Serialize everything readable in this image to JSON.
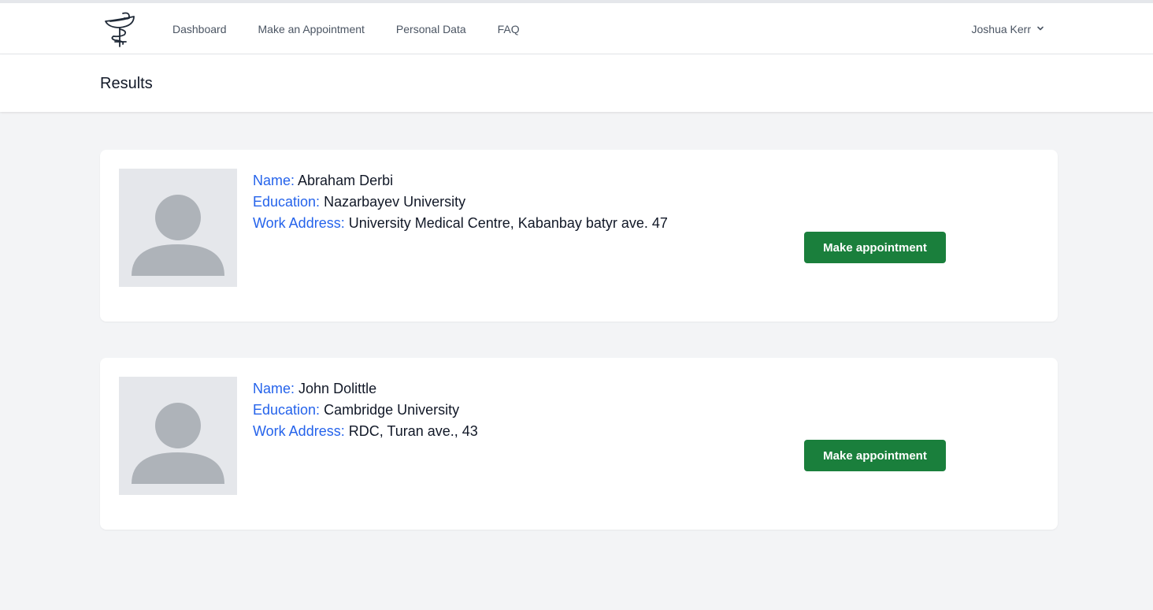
{
  "nav": {
    "links": [
      "Dashboard",
      "Make an Appointment",
      "Personal Data",
      "FAQ"
    ],
    "user_name": "Joshua Kerr"
  },
  "header": {
    "title": "Results"
  },
  "results": [
    {
      "name_label": "Name:",
      "name": "Abraham Derbi",
      "education_label": "Education:",
      "education": "Nazarbayev University",
      "address_label": "Work Address:",
      "address": "University Medical Centre, Kabanbay batyr ave. 47",
      "button_label": "Make appointment"
    },
    {
      "name_label": "Name:",
      "name": "John Dolittle",
      "education_label": "Education:",
      "education": "Cambridge University",
      "address_label": "Work Address:",
      "address": "RDC, Turan ave., 43",
      "button_label": "Make appointment"
    }
  ],
  "colors": {
    "accent_label": "#2563eb",
    "button_green": "#1a7f3c",
    "page_bg": "#f3f4f6"
  },
  "icons": {
    "logo": "caduceus-bowl-icon",
    "avatar": "user-placeholder-icon",
    "dropdown": "chevron-down-icon"
  }
}
